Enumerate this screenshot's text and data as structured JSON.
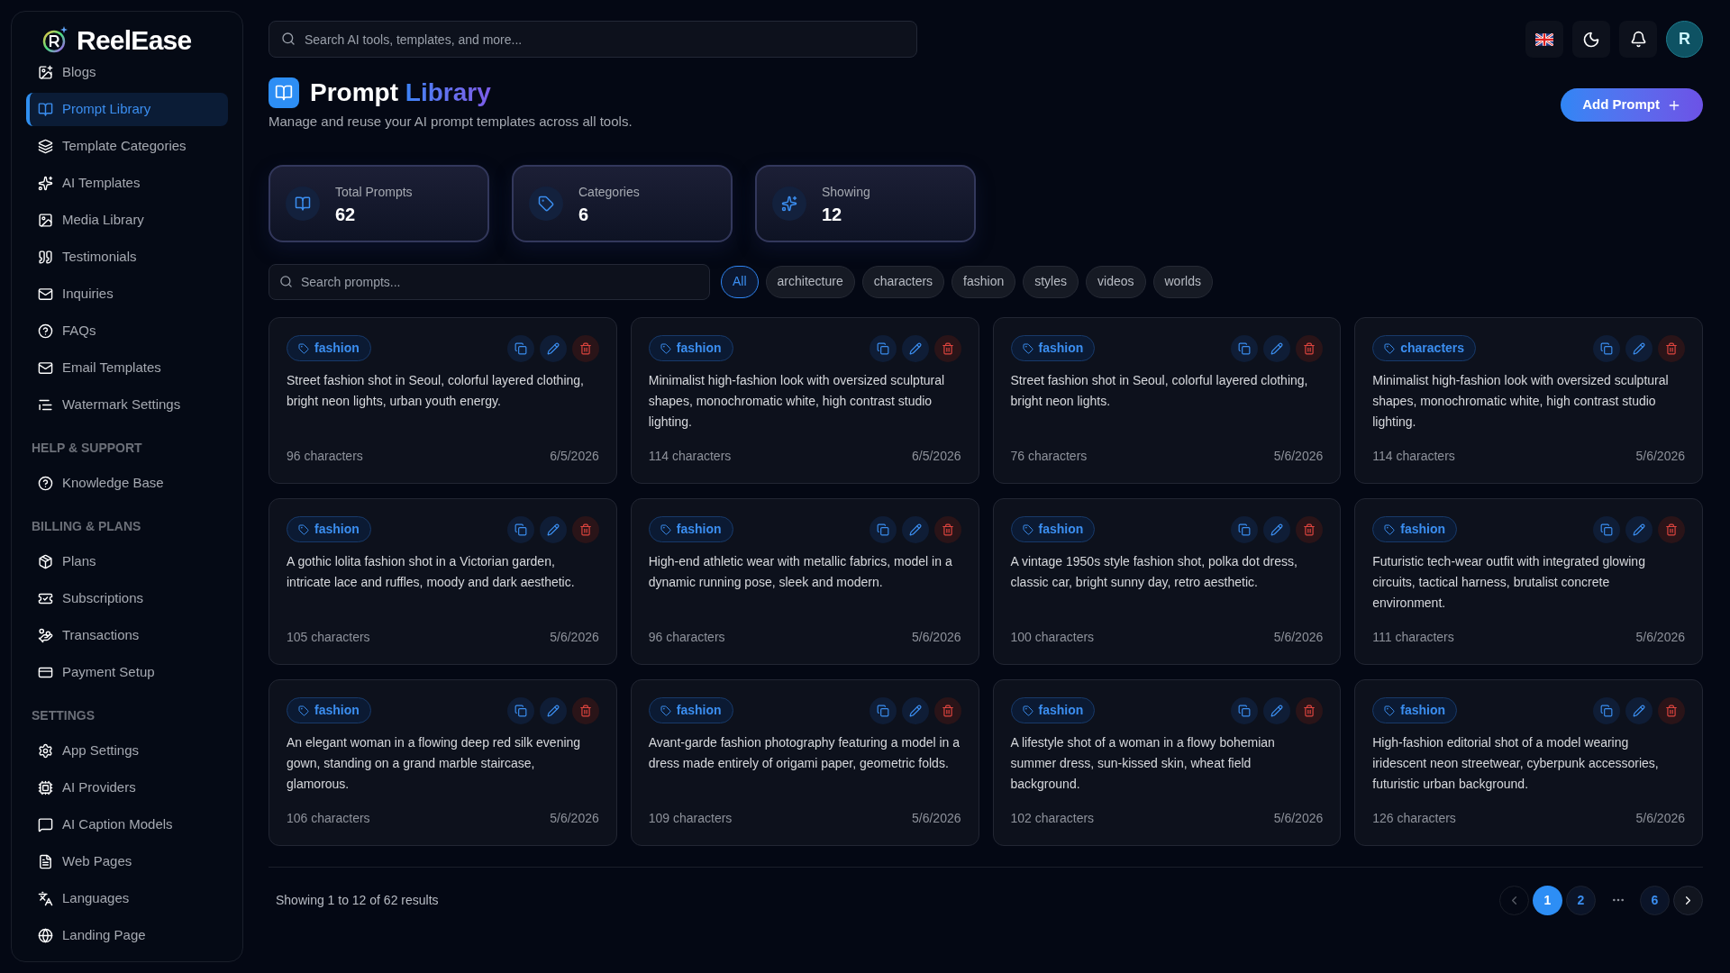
{
  "brand": {
    "name": "ReelEase"
  },
  "sidebar": {
    "items": [
      {
        "label": "Blogs",
        "selected": false
      },
      {
        "label": "Prompt Library",
        "selected": true
      },
      {
        "label": "Template Categories",
        "selected": false
      },
      {
        "label": "AI Templates",
        "selected": false
      },
      {
        "label": "Media Library",
        "selected": false
      },
      {
        "label": "Testimonials",
        "selected": false
      },
      {
        "label": "Inquiries",
        "selected": false
      },
      {
        "label": "FAQs",
        "selected": false
      },
      {
        "label": "Email Templates",
        "selected": false
      },
      {
        "label": "Watermark Settings",
        "selected": false
      }
    ],
    "sections": [
      {
        "title": "HELP & SUPPORT",
        "items": [
          {
            "label": "Knowledge Base",
            "selected": false
          }
        ]
      },
      {
        "title": "BILLING & PLANS",
        "items": [
          {
            "label": "Plans",
            "selected": false
          },
          {
            "label": "Subscriptions",
            "selected": false
          },
          {
            "label": "Transactions",
            "selected": false
          },
          {
            "label": "Payment Setup",
            "selected": false
          }
        ]
      },
      {
        "title": "SETTINGS",
        "items": [
          {
            "label": "App Settings",
            "selected": false
          },
          {
            "label": "AI Providers",
            "selected": false
          },
          {
            "label": "AI Caption Models",
            "selected": false
          },
          {
            "label": "Web Pages",
            "selected": false
          },
          {
            "label": "Languages",
            "selected": false
          },
          {
            "label": "Landing Page",
            "selected": false
          }
        ]
      }
    ]
  },
  "topbar": {
    "search": {
      "placeholder": "Search AI tools, templates, and more..."
    },
    "avatar": "R"
  },
  "header": {
    "title": "Prompt",
    "title_accent": "Library",
    "subtitle": "Manage and reuse your AI prompt templates across all tools.",
    "add_button": "Add Prompt"
  },
  "stats": [
    {
      "label": "Total Prompts",
      "value": "62"
    },
    {
      "label": "Categories",
      "value": "6"
    },
    {
      "label": "Showing",
      "value": "12"
    }
  ],
  "filter": {
    "search": {
      "placeholder": "Search prompts..."
    },
    "chips": [
      {
        "label": "All",
        "selected": true
      },
      {
        "label": "architecture",
        "selected": false
      },
      {
        "label": "characters",
        "selected": false
      },
      {
        "label": "fashion",
        "selected": false
      },
      {
        "label": "styles",
        "selected": false
      },
      {
        "label": "videos",
        "selected": false
      },
      {
        "label": "worlds",
        "selected": false
      }
    ]
  },
  "prompts": [
    {
      "tag": "fashion",
      "text": "Street fashion shot in Seoul, colorful layered clothing, bright neon lights, urban youth energy.",
      "count": "96 characters",
      "date": "6/5/2026"
    },
    {
      "tag": "fashion",
      "text": "Minimalist high-fashion look with oversized sculptural shapes, monochromatic white, high contrast studio lighting.",
      "count": "114 characters",
      "date": "6/5/2026"
    },
    {
      "tag": "fashion",
      "text": "Street fashion shot in Seoul, colorful layered clothing, bright neon lights.",
      "count": "76 characters",
      "date": "5/6/2026"
    },
    {
      "tag": "characters",
      "text": "Minimalist high-fashion look with oversized sculptural shapes, monochromatic white, high contrast studio lighting.",
      "count": "114 characters",
      "date": "5/6/2026"
    },
    {
      "tag": "fashion",
      "text": "A gothic lolita fashion shot in a Victorian garden, intricate lace and ruffles, moody and dark aesthetic.",
      "count": "105 characters",
      "date": "5/6/2026"
    },
    {
      "tag": "fashion",
      "text": "High-end athletic wear with metallic fabrics, model in a dynamic running pose, sleek and modern.",
      "count": "96 characters",
      "date": "5/6/2026"
    },
    {
      "tag": "fashion",
      "text": "A vintage 1950s style fashion shot, polka dot dress, classic car, bright sunny day, retro aesthetic.",
      "count": "100 characters",
      "date": "5/6/2026"
    },
    {
      "tag": "fashion",
      "text": "Futuristic tech-wear outfit with integrated glowing circuits, tactical harness, brutalist concrete environment.",
      "count": "111 characters",
      "date": "5/6/2026"
    },
    {
      "tag": "fashion",
      "text": "An elegant woman in a flowing deep red silk evening gown, standing on a grand marble staircase, glamorous.",
      "count": "106 characters",
      "date": "5/6/2026"
    },
    {
      "tag": "fashion",
      "text": "Avant-garde fashion photography featuring a model in a dress made entirely of origami paper, geometric folds.",
      "count": "109 characters",
      "date": "5/6/2026"
    },
    {
      "tag": "fashion",
      "text": "A lifestyle shot of a woman in a flowy bohemian summer dress, sun-kissed skin, wheat field background.",
      "count": "102 characters",
      "date": "5/6/2026"
    },
    {
      "tag": "fashion",
      "text": "High-fashion editorial shot of a model wearing iridescent neon streetwear, cyberpunk accessories, futuristic urban background.",
      "count": "126 characters",
      "date": "5/6/2026"
    }
  ],
  "pagination": {
    "summary": "Showing 1 to 12 of 62 results",
    "prev_disabled": true,
    "pages": [
      {
        "label": "1",
        "selected": true
      },
      {
        "label": "2",
        "selected": false
      },
      {
        "kind": "gap"
      },
      {
        "label": "6",
        "selected": false
      }
    ]
  }
}
